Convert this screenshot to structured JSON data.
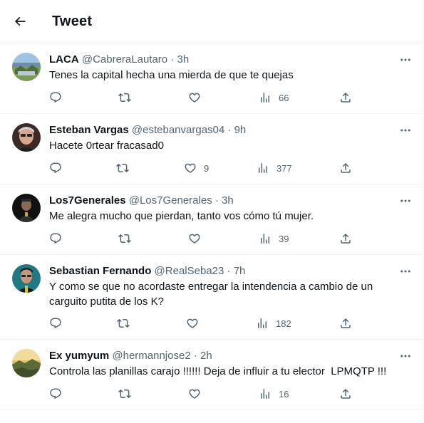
{
  "header": {
    "title": "Tweet"
  },
  "tweets": [
    {
      "name": "LACA",
      "handle": "@CabreraLautaro",
      "time": "3h",
      "text": "Tenes la capital hecha una mierda de que te quejas",
      "likes": "",
      "views": "66"
    },
    {
      "name": "Esteban Vargas",
      "handle": "@estebanvargas04",
      "time": "9h",
      "text": "Hacete 0rtear fracasad0",
      "likes": "9",
      "views": "377"
    },
    {
      "name": "Los7Generales",
      "handle": "@Los7Generales",
      "time": "3h",
      "text": "Me alegra mucho que pierdan, tanto vos cómo tú mujer.",
      "likes": "",
      "views": "39"
    },
    {
      "name": "Sebastian Fernando",
      "handle": "@RealSeba23",
      "time": "7h",
      "text": "Y como se que no acordaste entregar la intendencia a cambio de un carguito putita de los K?",
      "likes": "",
      "views": "182"
    },
    {
      "name": "Ex yumyum",
      "handle": "@hermannjose2",
      "time": "2h",
      "text": "Controla las planillas carajo !!!!!! Deja de influir a tu elector  LPMQTP !!!",
      "likes": "",
      "views": "16"
    }
  ],
  "separator": "·",
  "icons": {
    "back": "arrow-left-icon",
    "more": "more-horizontal-icon",
    "reply": "reply-icon",
    "retweet": "retweet-icon",
    "like": "heart-icon",
    "views": "bar-chart-icon",
    "share": "share-icon"
  },
  "colors": {
    "text": "#0f1419",
    "secondary": "#536471",
    "border": "#eff3f4"
  }
}
